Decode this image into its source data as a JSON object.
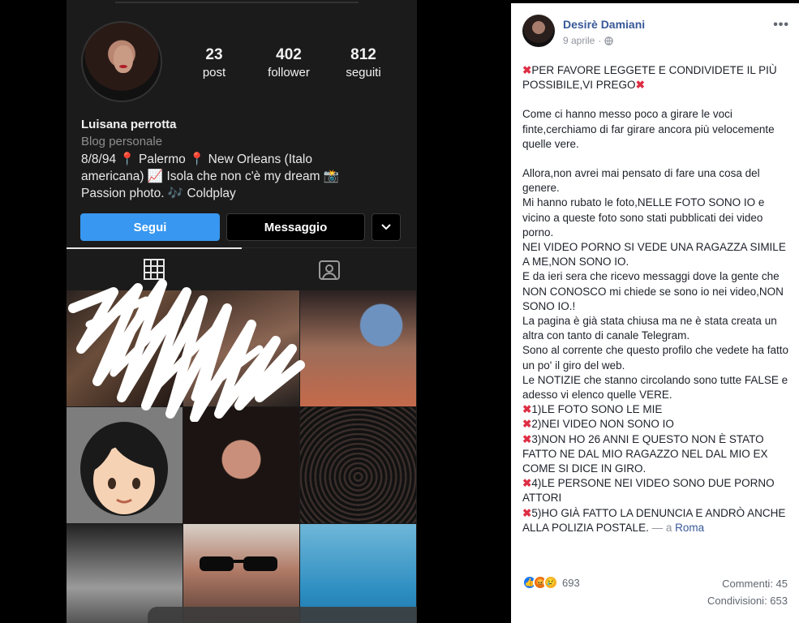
{
  "instagram": {
    "stats": [
      {
        "num": "23",
        "label": "post"
      },
      {
        "num": "402",
        "label": "follower"
      },
      {
        "num": "812",
        "label": "seguiti"
      }
    ],
    "name": "Luisana perrotta",
    "category": "Blog personale",
    "bio_lines": [
      "8/8/94 📍 Palermo 📍 New Orleans (Italo",
      "americana) 📈 Isola che non c'è my dream 📸",
      "Passion photo. 🎶 Coldplay"
    ],
    "buttons": {
      "follow": "Segui",
      "message": "Messaggio"
    }
  },
  "post": {
    "author": "Desirè Damiani",
    "date": "9 aprile",
    "paragraphs": [
      "PER FAVORE LEGGETE E CONDIVIDETE IL PIÙ POSSIBILE,VI PREGO",
      "",
      "Come ci hanno messo poco a girare le voci finte,cerchiamo di far girare ancora più velocemente quelle vere.",
      "",
      "Allora,non avrei mai pensato di fare una cosa del genere.",
      "Mi hanno rubato le foto,NELLE FOTO SONO IO e vicino a queste foto sono stati pubblicati dei video porno.",
      "NEI VIDEO PORNO SI VEDE UNA RAGAZZA SIMILE A ME,NON SONO IO.",
      "E da ieri sera che ricevo messaggi dove la gente che NON CONOSCO mi chiede se sono io nei video,NON SONO IO.!",
      "La pagina è già stata chiusa ma ne è stata creata un altra con tanto di canale Telegram.",
      "Sono al corrente che questo profilo che vedete ha fatto un po' il giro del web.",
      "Le NOTIZIE che stanno circolando sono tutte FALSE e adesso vi elenco quelle VERE.",
      "1)LE FOTO SONO LE MIE",
      "2)NEI VIDEO NON SONO IO",
      "3)NON HO 26 ANNI E QUESTO NON È STATO FATTO NE DAL MIO RAGAZZO NEL DAL MIO EX COME SI DICE IN GIRO.",
      "4)LE PERSONE NEI VIDEO SONO DUE PORNO ATTORI",
      "5)HO GIÀ FATTO LA DENUNCIA E ANDRÒ ANCHE ALLA POLIZIA POSTALE."
    ],
    "location_prefix": "— a",
    "location": "Roma",
    "reactions_count": "693",
    "comments": "Commenti: 45",
    "shares": "Condivisioni: 653"
  }
}
